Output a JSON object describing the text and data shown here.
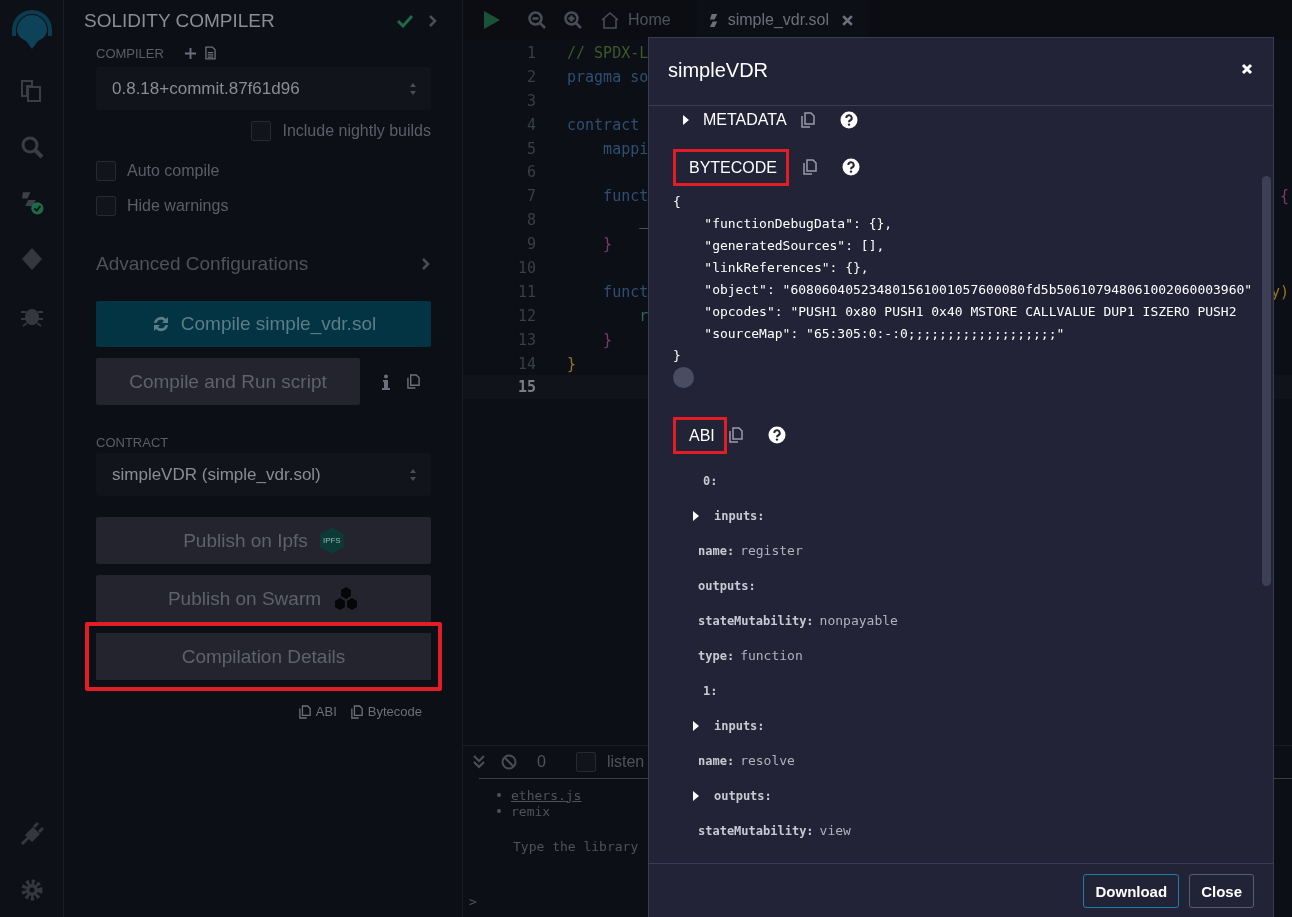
{
  "side_panel": {
    "title": "SOLIDITY COMPILER",
    "compiler_label": "COMPILER",
    "compiler_version": "0.8.18+commit.87f61d96",
    "nightly": {
      "label": "Include nightly builds",
      "checked": false
    },
    "options": [
      {
        "label": "Auto compile",
        "checked": false
      },
      {
        "label": "Hide warnings",
        "checked": false
      }
    ],
    "advanced": "Advanced Configurations",
    "compile_button": "Compile simple_vdr.sol",
    "run_script_button": "Compile and Run script",
    "contract_label": "CONTRACT",
    "contract": "simpleVDR (simple_vdr.sol)",
    "buttons": [
      {
        "label": "Publish on Ipfs",
        "kind": "ipfs",
        "badge": "IPFS",
        "highlighted": false
      },
      {
        "label": "Publish on Swarm",
        "kind": "swarm",
        "highlighted": false
      },
      {
        "label": "Compilation Details",
        "kind": "plain",
        "highlighted": true
      }
    ],
    "copy_links": [
      "ABI",
      "Bytecode"
    ]
  },
  "editor": {
    "tabs": [
      {
        "label": "Home",
        "kind": "home",
        "selected": false
      },
      {
        "label": "simple_vdr.sol",
        "kind": "file",
        "selected": true
      }
    ],
    "lines": [
      {
        "number": "1",
        "text": "// SPDX-L",
        "kind": "comment",
        "current": false
      },
      {
        "number": "2",
        "text": "pragma so",
        "kind": "keyword",
        "current": false
      },
      {
        "number": "3",
        "current": false
      },
      {
        "number": "4",
        "text": "contract",
        "kind": "keyword",
        "current": false
      },
      {
        "number": "5",
        "text": "    mappi",
        "kind": "keyword",
        "current": false
      },
      {
        "number": "6",
        "current": false
      },
      {
        "number": "7",
        "text": "    funct",
        "kind": "keyword",
        "tail": {
          "text": "{",
          "kind": "magenta"
        },
        "current": false
      },
      {
        "number": "8",
        "text": "        _",
        "kind": "plain",
        "current": false
      },
      {
        "number": "9",
        "text": "    }",
        "kind": "magenta",
        "current": false
      },
      {
        "number": "10",
        "current": false
      },
      {
        "number": "11",
        "text": "    funct",
        "kind": "keyword",
        "tail": {
          "text": "y)",
          "kind": "orange"
        },
        "current": false
      },
      {
        "number": "12",
        "text": "        r",
        "kind": "teal",
        "current": false
      },
      {
        "number": "13",
        "text": "    }",
        "kind": "magenta",
        "current": false
      },
      {
        "number": "14",
        "text": "}",
        "kind": "orange",
        "current": false
      },
      {
        "number": "15",
        "current": true
      }
    ]
  },
  "console": {
    "count": "0",
    "listen": {
      "label": "listen",
      "checked": false
    },
    "items": [
      {
        "text": "ethers.js",
        "kind": "link"
      },
      {
        "text": "remix",
        "kind": "plain"
      }
    ],
    "hint": "Type the library",
    "prompt": ">"
  },
  "modal": {
    "title": "simpleVDR",
    "metadata": {
      "label": "METADATA",
      "collapsed": true
    },
    "bytecode": {
      "label": "BYTECODE",
      "highlighted": true,
      "lines": [
        "{",
        "    \"functionDebugData\": {},",
        "    \"generatedSources\": [],",
        "    \"linkReferences\": {},",
        "    \"object\": \"608060405234801561001057600080fd5b506107948061002060003960\"",
        "    \"opcodes\": \"PUSH1 0x80 PUSH1 0x40 MSTORE CALLVALUE DUP1 ISZERO PUSH2",
        "    \"sourceMap\": \"65:305:0:-:0;;;;;;;;;;;;;;;;;;;\"",
        "}"
      ]
    },
    "abi": {
      "label": "ABI",
      "highlighted": true,
      "entries": [
        {
          "kind": "index",
          "key": "0:",
          "collapsed": false
        },
        {
          "kind": "field",
          "key": "inputs:",
          "collapsed": true
        },
        {
          "kind": "field",
          "key": "name:",
          "value": "register",
          "collapsed": false
        },
        {
          "kind": "field",
          "key": "outputs:",
          "collapsed": false
        },
        {
          "kind": "field",
          "key": "stateMutability:",
          "value": "nonpayable",
          "collapsed": false
        },
        {
          "kind": "field",
          "key": "type:",
          "value": "function",
          "collapsed": false
        },
        {
          "kind": "index",
          "key": "1:",
          "collapsed": false
        },
        {
          "kind": "field",
          "key": "inputs:",
          "collapsed": true
        },
        {
          "kind": "field",
          "key": "name:",
          "value": "resolve",
          "collapsed": false
        },
        {
          "kind": "field",
          "key": "outputs:",
          "collapsed": true
        },
        {
          "kind": "field",
          "key": "stateMutability:",
          "value": "view",
          "collapsed": false
        }
      ]
    },
    "buttons": [
      {
        "label": "Download",
        "kind": "primary"
      },
      {
        "label": "Close",
        "kind": "secondary"
      }
    ]
  }
}
